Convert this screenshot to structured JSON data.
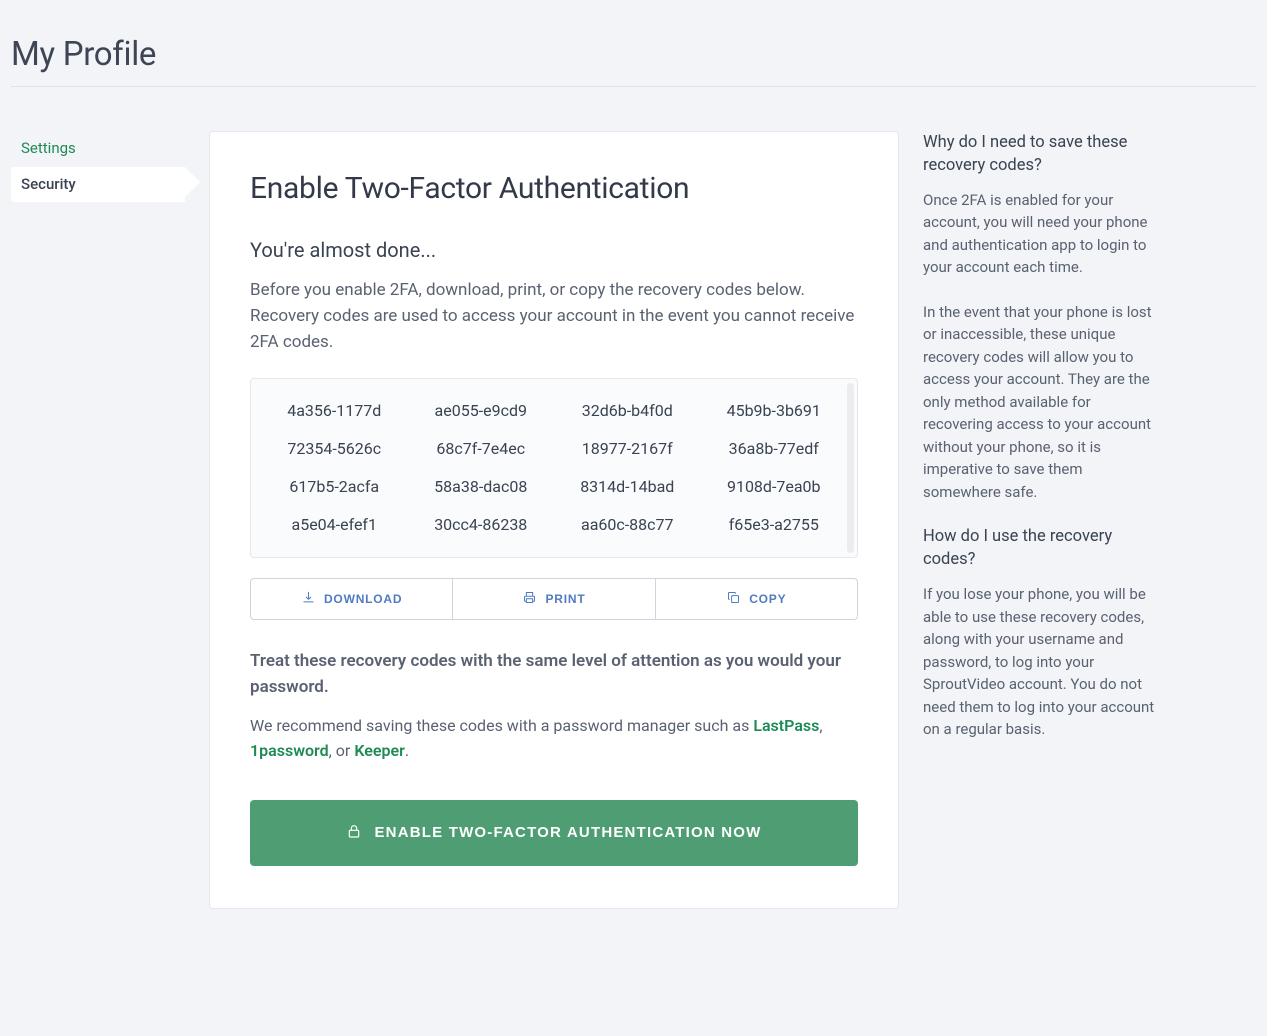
{
  "header": {
    "title": "My Profile"
  },
  "sidebar": {
    "items": [
      {
        "label": "Settings",
        "active": false
      },
      {
        "label": "Security",
        "active": true
      }
    ]
  },
  "card": {
    "title": "Enable Two-Factor Authentication",
    "subheading": "You're almost done...",
    "lead": "Before you enable 2FA, download, print, or copy the recovery codes below. Recovery codes are used to access your account in the event you cannot receive 2FA codes.",
    "codes": [
      "4a356-1177d",
      "ae055-e9cd9",
      "32d6b-b4f0d",
      "45b9b-3b691",
      "72354-5626c",
      "68c7f-7e4ec",
      "18977-2167f",
      "36a8b-77edf",
      "617b5-2acfa",
      "58a38-dac08",
      "8314d-14bad",
      "9108d-7ea0b",
      "a5e04-efef1",
      "30cc4-86238",
      "aa60c-88c77",
      "f65e3-a2755"
    ],
    "buttons": {
      "download": "DOWNLOAD",
      "print": "PRINT",
      "copy": "COPY"
    },
    "treat": "Treat these recovery codes with the same level of attention as you would your password.",
    "recommend_pre": "We recommend saving these codes with a password manager such as ",
    "link_lastpass": "LastPass",
    "sep1": ", ",
    "link_1password": "1password",
    "sep2": ", or ",
    "link_keeper": "Keeper",
    "recommend_post": ".",
    "primary_label": "ENABLE TWO-FACTOR AUTHENTICATION NOW"
  },
  "info": {
    "q1": "Why do I need to save these recovery codes?",
    "a1a": "Once 2FA is enabled for your account, you will need your phone and authentication app to login to your account each time.",
    "a1b": "In the event that your phone is lost or inaccessible, these unique recovery codes will allow you to access your account. They are the only method available for recovering access to your account without your phone, so it is imperative to save them somewhere safe.",
    "q2": "How do I use the recovery codes?",
    "a2": "If you lose your phone, you will be able to use these recovery codes, along with your username and password, to log into your SproutVideo account. You do not need them to log into your account on a regular basis."
  }
}
